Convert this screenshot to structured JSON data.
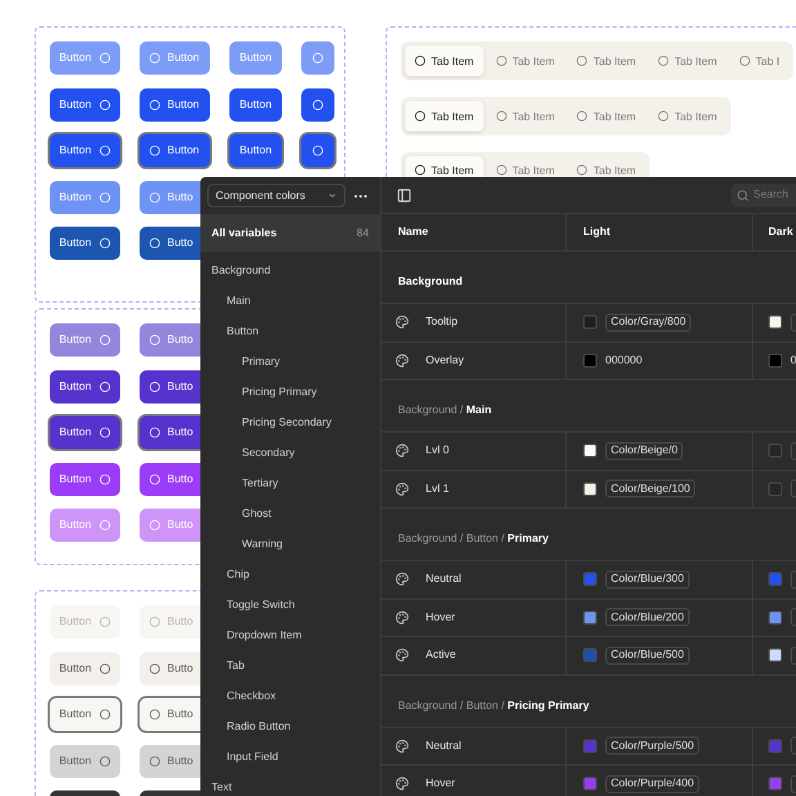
{
  "canvas": {
    "button_groups": [
      {
        "rows": [
          {
            "color": "#7d9cf6",
            "kind": "inverse",
            "outlined": false,
            "buttons": [
              {
                "label": "Button",
                "kind": "trailing-icon"
              },
              {
                "label": "Button",
                "kind": "leading-icon"
              },
              {
                "label": "Button",
                "kind": "text"
              },
              {
                "kind": "icon"
              }
            ]
          },
          {
            "color": "#2251f0",
            "kind": "inverse",
            "outlined": false,
            "buttons": [
              {
                "label": "Button",
                "kind": "trailing-icon"
              },
              {
                "label": "Button",
                "kind": "leading-icon"
              },
              {
                "label": "Button",
                "kind": "text"
              },
              {
                "kind": "icon"
              }
            ]
          },
          {
            "color": "#2251f0",
            "kind": "inverse",
            "outlined": true,
            "buttons": [
              {
                "label": "Button",
                "kind": "trailing-icon"
              },
              {
                "label": "Button",
                "kind": "leading-icon"
              },
              {
                "label": "Button",
                "kind": "text"
              },
              {
                "kind": "icon"
              }
            ]
          },
          {
            "color": "#6f93f4",
            "kind": "inverse",
            "outlined": false,
            "buttons": [
              {
                "label": "Button",
                "kind": "trailing-icon"
              },
              {
                "label": "Butto",
                "kind": "clipped"
              }
            ]
          },
          {
            "color": "#1c56b0",
            "kind": "inverse",
            "outlined": false,
            "buttons": [
              {
                "label": "Button",
                "kind": "trailing-icon"
              },
              {
                "label": "Butto",
                "kind": "clipped"
              }
            ]
          }
        ]
      },
      {
        "rows": [
          {
            "color": "#9486dd",
            "kind": "inverse",
            "outlined": false,
            "buttons": [
              {
                "label": "Button",
                "kind": "trailing-icon"
              },
              {
                "label": "Butto",
                "kind": "clipped"
              }
            ]
          },
          {
            "color": "#5533cc",
            "kind": "inverse",
            "outlined": false,
            "buttons": [
              {
                "label": "Button",
                "kind": "trailing-icon"
              },
              {
                "label": "Butto",
                "kind": "clipped"
              }
            ]
          },
          {
            "color": "#5533cc",
            "kind": "inverse",
            "outlined": true,
            "buttons": [
              {
                "label": "Button",
                "kind": "trailing-icon"
              },
              {
                "label": "Butto",
                "kind": "clipped"
              }
            ]
          },
          {
            "color": "#9b3cf6",
            "kind": "inverse",
            "outlined": false,
            "buttons": [
              {
                "label": "Button",
                "kind": "trailing-icon"
              },
              {
                "label": "Butto",
                "kind": "clipped"
              }
            ]
          },
          {
            "color": "#cf94f8",
            "kind": "inverse",
            "outlined": false,
            "buttons": [
              {
                "label": "Button",
                "kind": "trailing-icon"
              },
              {
                "label": "Butto",
                "kind": "clipped"
              }
            ]
          }
        ]
      },
      {
        "rows": [
          {
            "color": "#f8f6f2",
            "kind": "faint",
            "outlined": false,
            "buttons": [
              {
                "label": "Button",
                "kind": "trailing-icon"
              },
              {
                "label": "Butto",
                "kind": "clipped"
              }
            ]
          },
          {
            "color": "#f3f0eb",
            "kind": "muted",
            "outlined": false,
            "buttons": [
              {
                "label": "Button",
                "kind": "trailing-icon"
              },
              {
                "label": "Butto",
                "kind": "clipped"
              }
            ]
          },
          {
            "color": "#f8f6f2",
            "kind": "muted",
            "outlined": true,
            "buttons": [
              {
                "label": "Button",
                "kind": "trailing-icon"
              },
              {
                "label": "Butto",
                "kind": "clipped"
              }
            ]
          },
          {
            "color": "#d4d4d4",
            "kind": "muted",
            "outlined": false,
            "buttons": [
              {
                "label": "Button",
                "kind": "trailing-icon"
              },
              {
                "label": "Butto",
                "kind": "clipped"
              }
            ]
          },
          {
            "color": "#333333",
            "kind": "inverse",
            "outlined": false,
            "buttons": [
              {
                "kind": "blank"
              },
              {
                "kind": "blank"
              }
            ]
          }
        ]
      }
    ],
    "tab_bars": [
      {
        "tabs": [
          {
            "label": "Tab Item",
            "selected": true
          },
          {
            "label": "Tab Item",
            "selected": false
          },
          {
            "label": "Tab Item",
            "selected": false
          },
          {
            "label": "Tab Item",
            "selected": false
          },
          {
            "label": "Tab I",
            "selected": false
          }
        ]
      },
      {
        "tabs": [
          {
            "label": "Tab Item",
            "selected": true
          },
          {
            "label": "Tab Item",
            "selected": false
          },
          {
            "label": "Tab Item",
            "selected": false
          },
          {
            "label": "Tab Item",
            "selected": false
          }
        ]
      },
      {
        "kind": "clipped",
        "tabs": [
          {
            "label": "Tab Item",
            "selected": true
          },
          {
            "label": "Tab Item",
            "selected": false
          },
          {
            "label": "Tab Item",
            "selected": false
          }
        ]
      }
    ]
  },
  "panel": {
    "collection": "Component colors",
    "all_variables": {
      "label": "All variables",
      "count": "84",
      "selected": true
    },
    "tree": [
      {
        "label": "Background",
        "selected": false,
        "children": [
          {
            "label": "Main",
            "selected": false
          },
          {
            "label": "Button",
            "selected": false,
            "children": [
              {
                "label": "Primary",
                "selected": false
              },
              {
                "label": "Pricing Primary",
                "selected": false
              },
              {
                "label": "Pricing Secondary",
                "selected": false
              },
              {
                "label": "Secondary",
                "selected": false
              },
              {
                "label": "Tertiary",
                "selected": false
              },
              {
                "label": "Ghost",
                "selected": false
              },
              {
                "label": "Warning",
                "selected": false
              }
            ]
          },
          {
            "label": "Chip",
            "selected": false
          },
          {
            "label": "Toggle Switch",
            "selected": false
          },
          {
            "label": "Dropdown Item",
            "selected": false
          },
          {
            "label": "Tab",
            "selected": false
          },
          {
            "label": "Checkbox",
            "selected": false
          },
          {
            "label": "Radio Button",
            "selected": false
          },
          {
            "label": "Input Field",
            "selected": false
          }
        ]
      },
      {
        "label": "Text",
        "selected": false
      }
    ],
    "search": {
      "placeholder": "Search"
    },
    "table": {
      "columns": [
        "Name",
        "Light",
        "Dark"
      ],
      "sections": [
        {
          "name": "Background",
          "rows": [
            {
              "name": "Tooltip",
              "light": {
                "kind": "alias",
                "color": "#1e1e1e",
                "value": "Color/Gray/800"
              },
              "dark": {
                "kind": "alias",
                "color": "#f7f4ee"
              }
            },
            {
              "name": "Overlay",
              "light": {
                "kind": "raw",
                "color": "#000000",
                "value": "000000"
              },
              "dark": {
                "kind": "raw",
                "color": "#000000",
                "value": "0"
              }
            }
          ]
        },
        {
          "parent": "Background / ",
          "name": "Main",
          "rows": [
            {
              "name": "Lvl 0",
              "light": {
                "kind": "alias",
                "color": "#fbf9f5",
                "value": "Color/Beige/0"
              },
              "dark": {
                "kind": "alias",
                "color": "#262626"
              }
            },
            {
              "name": "Lvl 1",
              "light": {
                "kind": "alias",
                "color": "#f5f1ea",
                "value": "Color/Beige/100"
              },
              "dark": {
                "kind": "alias",
                "color": "#262626"
              }
            }
          ]
        },
        {
          "parent": "Background / Button / ",
          "name": "Primary",
          "rows": [
            {
              "name": "Neutral",
              "light": {
                "kind": "alias",
                "color": "#2251f0",
                "value": "Color/Blue/300"
              },
              "dark": {
                "kind": "alias",
                "color": "#2251f0"
              }
            },
            {
              "name": "Hover",
              "light": {
                "kind": "alias",
                "color": "#6e93f0",
                "value": "Color/Blue/200"
              },
              "dark": {
                "kind": "alias",
                "color": "#6e93f0"
              }
            },
            {
              "name": "Active",
              "light": {
                "kind": "alias",
                "color": "#1f4fae",
                "value": "Color/Blue/500"
              },
              "dark": {
                "kind": "alias",
                "color": "#c9dcff"
              }
            }
          ]
        },
        {
          "parent": "Background / Button / ",
          "name": "Pricing Primary",
          "rows": [
            {
              "name": "Neutral",
              "light": {
                "kind": "alias",
                "color": "#5533cc",
                "value": "Color/Purple/500"
              },
              "dark": {
                "kind": "alias",
                "color": "#5533cc"
              }
            },
            {
              "name": "Hover",
              "light": {
                "kind": "alias",
                "color": "#9440f0",
                "value": "Color/Purple/400"
              },
              "dark": {
                "kind": "alias",
                "color": "#9440f0"
              }
            }
          ]
        }
      ]
    }
  }
}
